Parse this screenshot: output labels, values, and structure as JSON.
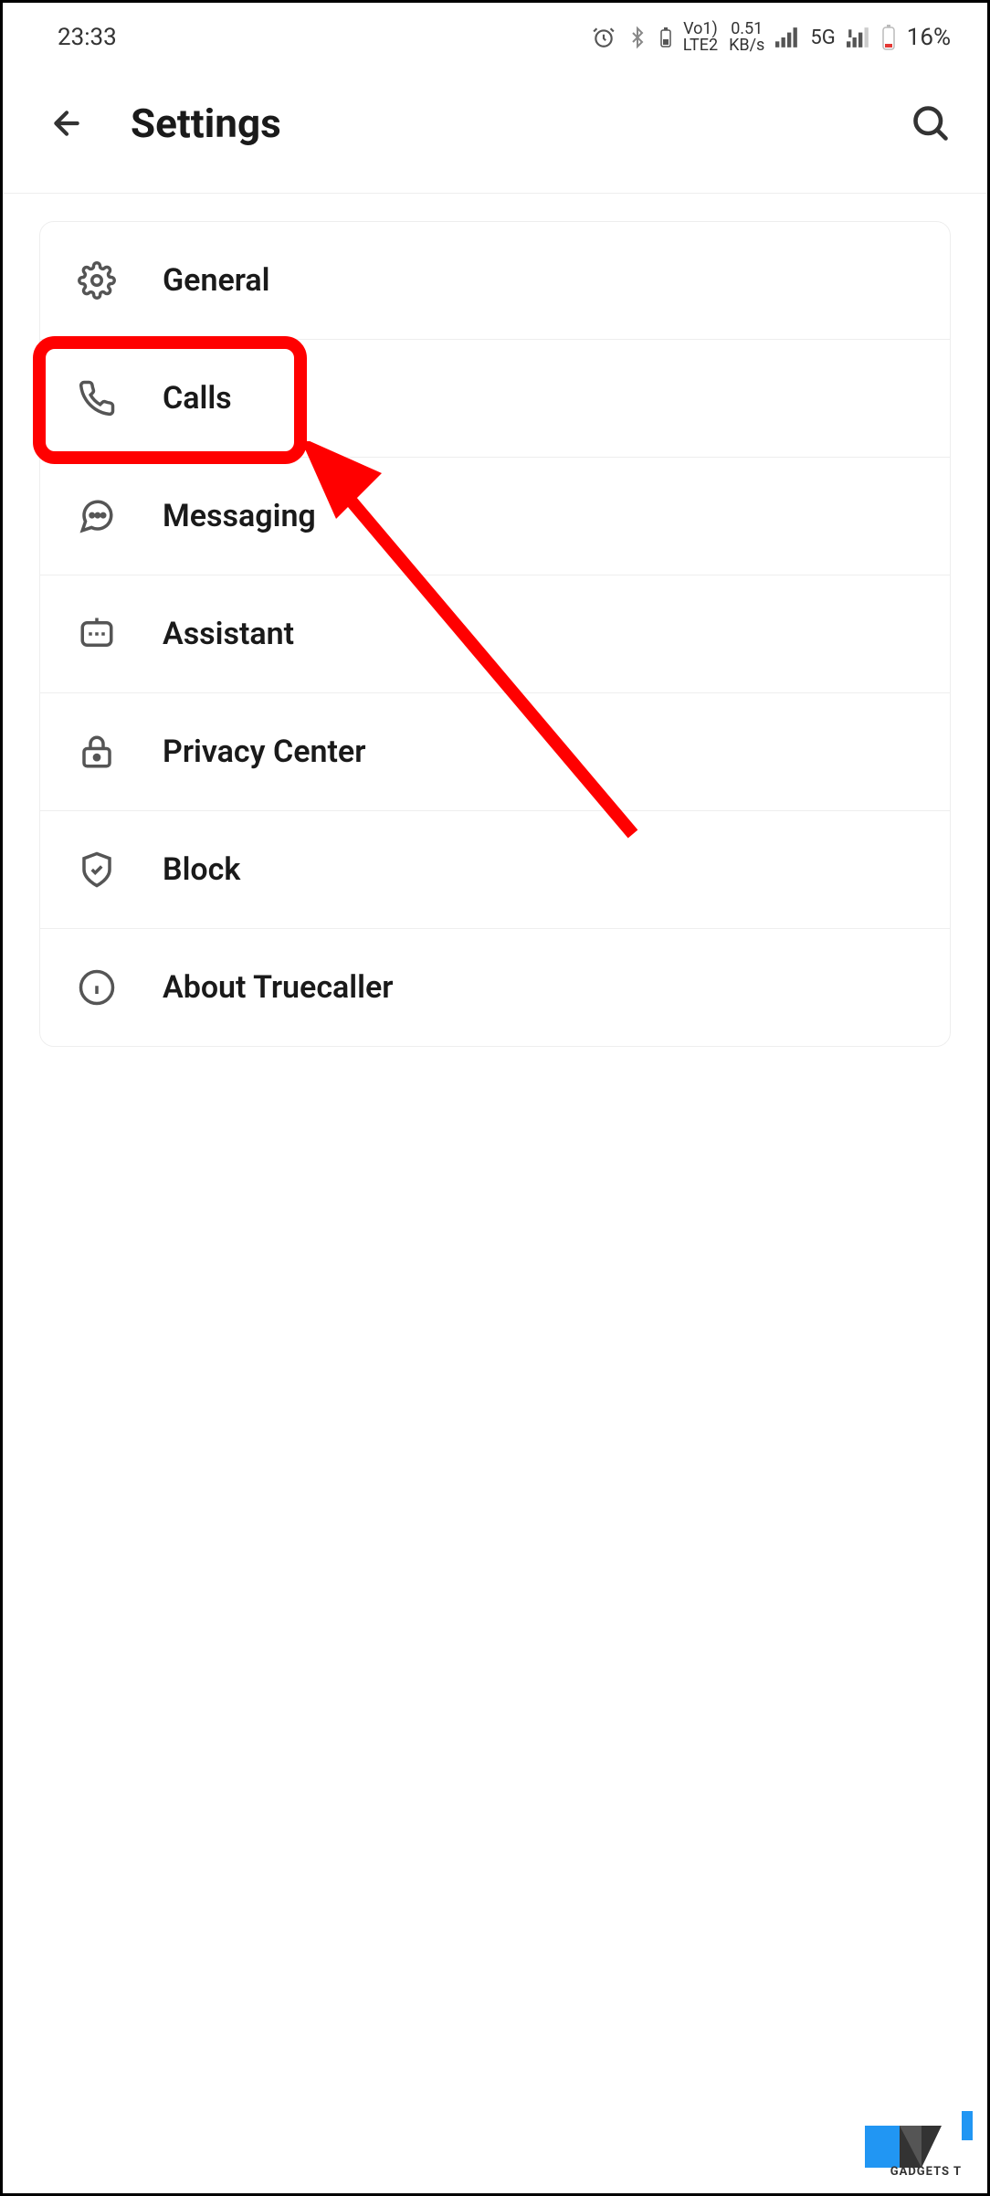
{
  "status": {
    "time": "23:33",
    "speed_top": "0.51",
    "speed_bottom": "KB/s",
    "volte_top": "Vo1)",
    "volte_bottom": "LTE2",
    "network": "5G",
    "battery": "16%"
  },
  "header": {
    "title": "Settings"
  },
  "items": [
    {
      "label": "General"
    },
    {
      "label": "Calls"
    },
    {
      "label": "Messaging"
    },
    {
      "label": "Assistant"
    },
    {
      "label": "Privacy Center"
    },
    {
      "label": "Block"
    },
    {
      "label": "About Truecaller"
    }
  ],
  "watermark": {
    "text": "GADGETS T"
  }
}
